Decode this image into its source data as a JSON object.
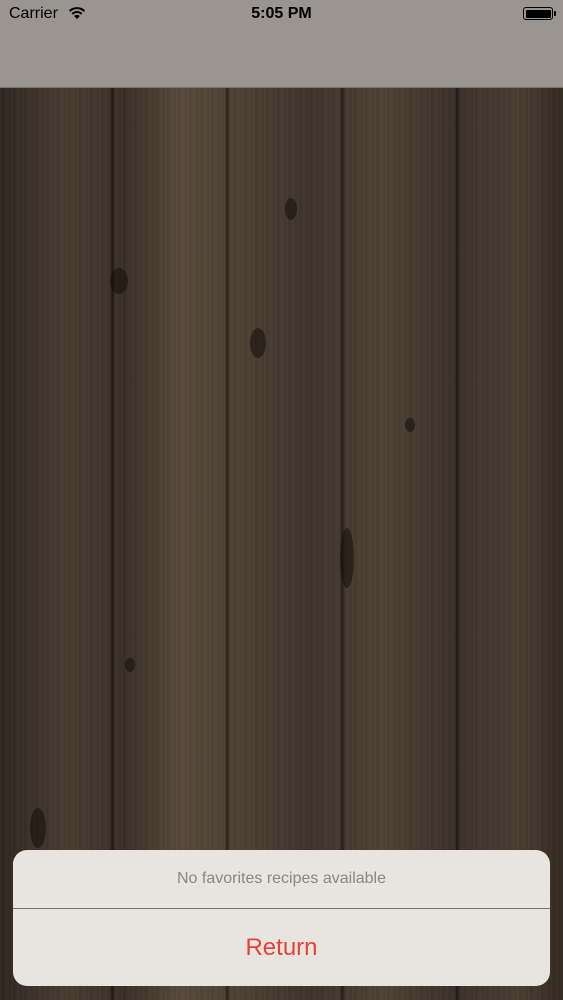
{
  "status_bar": {
    "carrier": "Carrier",
    "time": "5:05 PM",
    "wifi_icon": "wifi-icon",
    "battery_icon": "battery-full-icon"
  },
  "action_sheet": {
    "message": "No favorites recipes available",
    "return_label": "Return",
    "return_color": "#e5413d"
  }
}
